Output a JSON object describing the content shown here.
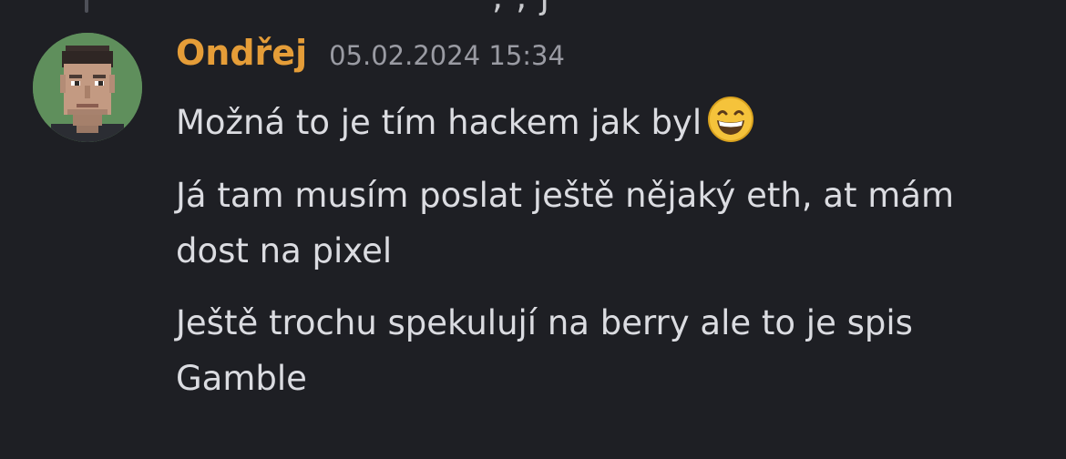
{
  "top_fragment": ", , j",
  "message_group": {
    "author": "Ondřej",
    "timestamp": "05.02.2024 15:34",
    "avatar_icon": "pixel-art-face-avatar",
    "author_color": "#e59d38",
    "messages": [
      {
        "text": "Možná to je tím hackem jak byl",
        "emoji": "grinning-face-with-smiling-eyes"
      },
      {
        "line1": "Já tam musím poslat ještě nějaký eth, at mám",
        "line2": "dost na pixel"
      },
      {
        "line1": "Ještě trochu spekulují na berry ale to je spis",
        "line2": "Gamble"
      }
    ]
  }
}
